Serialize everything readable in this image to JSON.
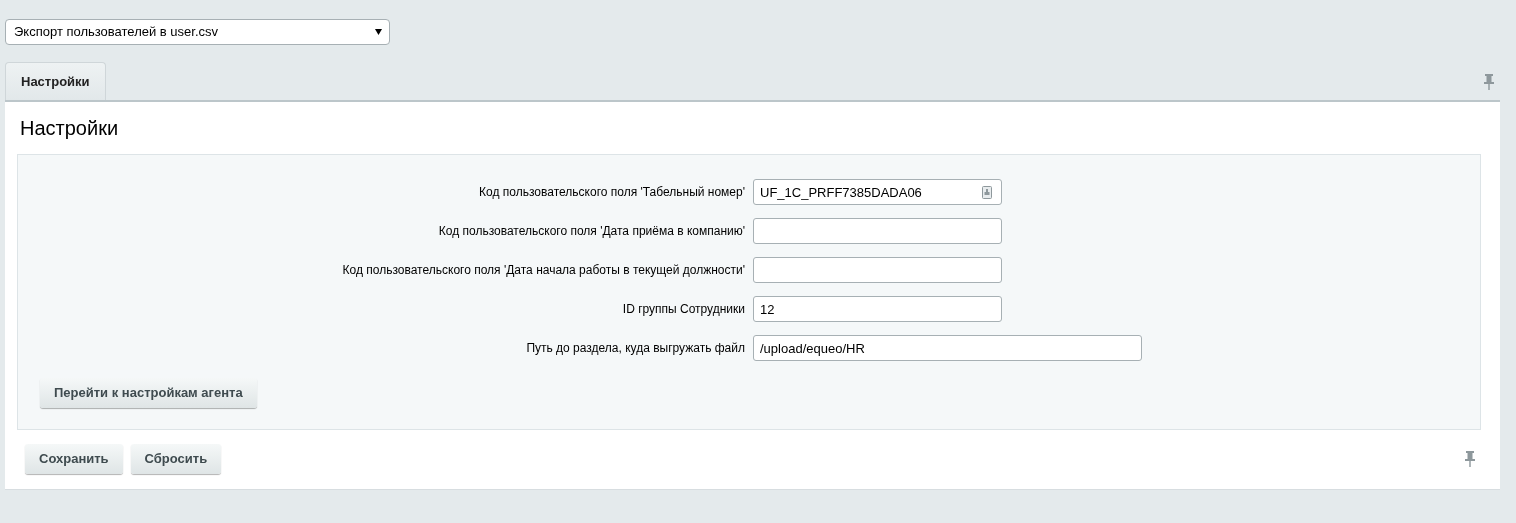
{
  "profile_select": {
    "value": "Экспорт пользователей в user.csv"
  },
  "tabs": [
    {
      "label": "Настройки",
      "selected": true
    }
  ],
  "panel": {
    "title": "Настройки",
    "fields": [
      {
        "label": "Код пользовательского поля 'Табельный номер'",
        "value": "UF_1C_PRFF7385DADA06",
        "kind": "with_icon"
      },
      {
        "label": "Код пользовательского поля 'Дата приёма в компанию'",
        "kind": "plain"
      },
      {
        "label": "Код пользовательского поля 'Дата начала работы в текущей должности'",
        "kind": "plain"
      },
      {
        "label": "ID группы Сотрудники",
        "value": "12",
        "kind": "plain"
      },
      {
        "label": "Путь до раздела, куда выгружать файл",
        "value": "/upload/equeo/HR",
        "kind": "wide"
      }
    ],
    "agent_button": "Перейти к настройкам агента"
  },
  "footer_buttons": [
    "Сохранить",
    "Сбросить"
  ]
}
